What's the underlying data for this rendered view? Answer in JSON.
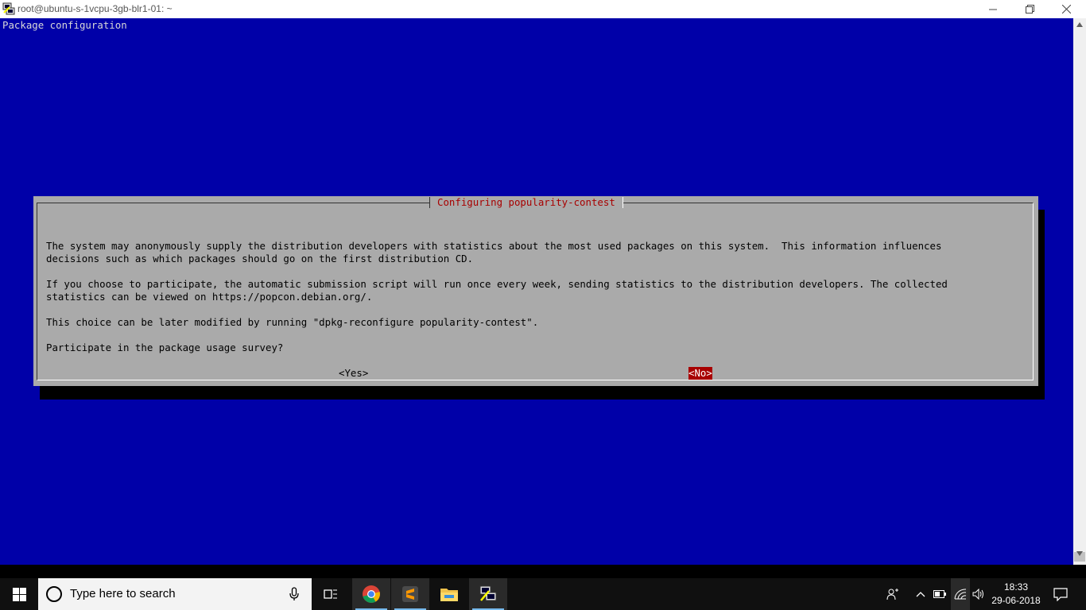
{
  "window": {
    "title": "root@ubuntu-s-1vcpu-3gb-blr1-01: ~",
    "controls": [
      "minimize-icon",
      "maximize-icon",
      "close-icon"
    ]
  },
  "terminal": {
    "header": "Package configuration",
    "dialog": {
      "title": "Configuring popularity-contest",
      "lines": [
        "The system may anonymously supply the distribution developers with statistics about the most used packages on this system.  This information influences",
        "decisions such as which packages should go on the first distribution CD.",
        "",
        "If you choose to participate, the automatic submission script will run once every week, sending statistics to the distribution developers. The collected",
        "statistics can be viewed on https://popcon.debian.org/.",
        "",
        "This choice can be later modified by running \"dpkg-reconfigure popularity-contest\".",
        "",
        "Participate in the package usage survey?"
      ],
      "yes_button": "<Yes>",
      "no_button": "<No>",
      "selected": "no"
    }
  },
  "taskbar": {
    "search_placeholder": "Type here to search",
    "apps": [
      "task-view-icon",
      "chrome-icon",
      "sublime-text-icon",
      "file-explorer-icon",
      "putty-icon"
    ],
    "tray": [
      "people-icon",
      "chevron-up-icon",
      "battery-icon",
      "wifi-icon",
      "volume-icon"
    ],
    "time": "18:33",
    "date": "29-06-2018",
    "notification": "action-center-icon"
  },
  "colors": {
    "terminal_bg": "#0000a8",
    "dialog_bg": "#aaaaaa",
    "accent_red": "#a80000"
  }
}
